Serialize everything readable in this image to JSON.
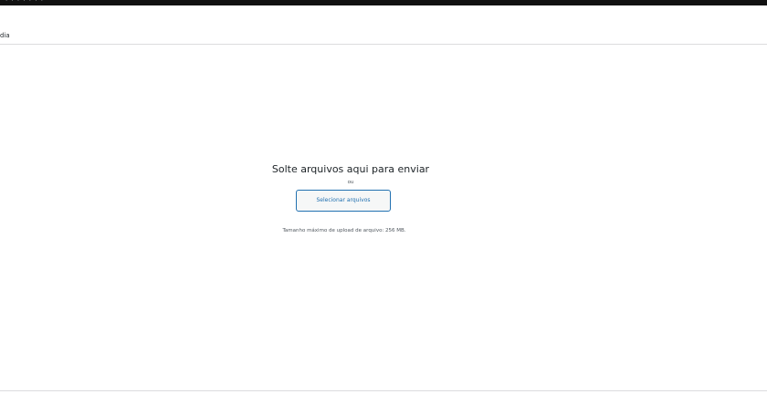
{
  "top_bar": {
    "residue_text": "· ·  ·  · ·  · ·"
  },
  "header": {
    "title": "dia"
  },
  "uploader": {
    "drop_title": "Solte arquivos aqui para enviar",
    "or_text": "ou",
    "select_button_label": "Selecionar arquivos",
    "max_size_text": "Tamanho máximo de upload de arquivo: 256 MB."
  },
  "colors": {
    "accent": "#2271b1",
    "text": "#1d2327",
    "muted": "#50575e",
    "border": "#dcdcde",
    "top_bar": "#111111"
  }
}
